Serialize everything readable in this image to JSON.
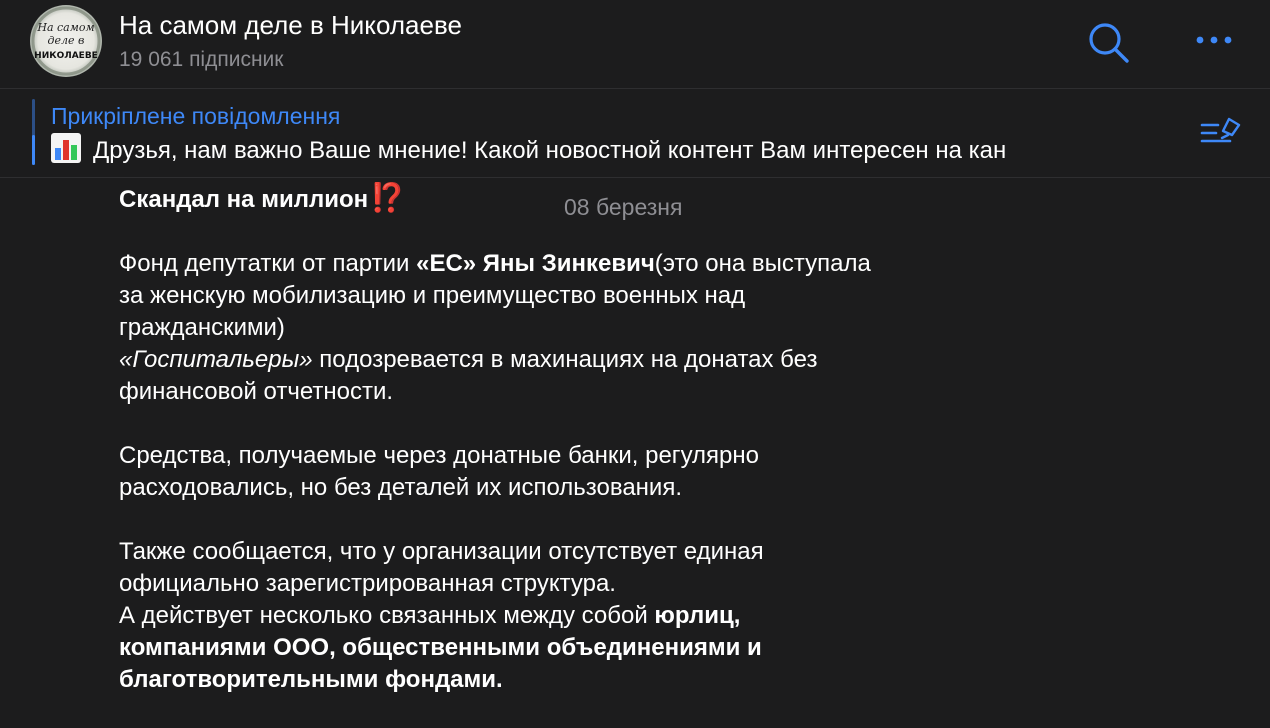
{
  "header": {
    "avatar_text": [
      "На самом",
      "деле в",
      "НИКОЛАЕВЕ"
    ],
    "title": "На самом деле в Николаеве",
    "subtitle": "19 061 підписник",
    "search_icon": "search-icon",
    "more_icon": "more-icon"
  },
  "pinned": {
    "title": "Прикріплене повідомлення",
    "icon": "chart-icon",
    "text": "Друзья, нам важно Ваше мнение!  Какой новостной контент Вам интересен на кан",
    "list_icon": "pinned-list-icon"
  },
  "date_label": "08 березня",
  "message": {
    "title": "Скандал на миллион",
    "title_emoji": "⁉️",
    "p1": {
      "t1": "Фонд депутатки от партии ",
      "b1": "«ЕС» Яны Зинкевич",
      "t2": "(это она выступала за женскую мобилизацию и преимущество военных над гражданскими)",
      "i1": "«Госпитальеры»",
      "t3": " подозревается в махинациях на донатах без  финансовой отчетности."
    },
    "p2": "Средства, получаемые через донатные банки, регулярно расходовались, но без деталей их использования.",
    "p3": {
      "t1": "Также сообщается, что у организации отсутствует единая официально зарегистрированная структура.",
      "t2": "А действует несколько связанных между собой ",
      "b1": "юрлиц, компаниями ООО, общественными объединениями и благотворительными фондами."
    }
  },
  "colors": {
    "background": "#1c1c1d",
    "accent": "#3e88f7",
    "secondary_text": "#8e8e93",
    "emoji_red": "#e0342c"
  }
}
